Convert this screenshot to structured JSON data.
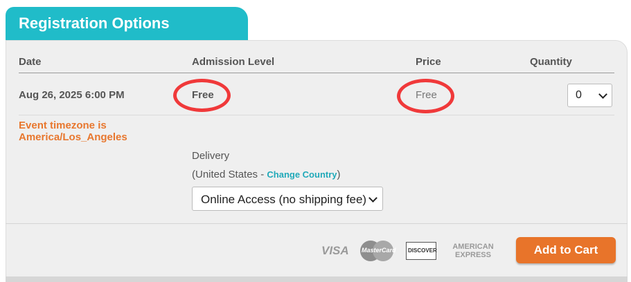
{
  "section": {
    "title": "Registration Options"
  },
  "table": {
    "headers": {
      "date": "Date",
      "admission": "Admission Level",
      "price": "Price",
      "quantity": "Quantity"
    },
    "row": {
      "date": "Aug 26, 2025 6:00 PM",
      "timezone": "Event timezone is America/Los_Angeles",
      "admission": "Free",
      "price": "Free",
      "quantity": "0"
    }
  },
  "delivery": {
    "label": "Delivery",
    "country_prefix": "(United States - ",
    "change_country": "Change Country",
    "country_suffix": ")",
    "shipping_option": "Online Access (no shipping fee)"
  },
  "payment": {
    "visa": "VISA",
    "mastercard": "MasterCard",
    "discover": "DISCOVER",
    "amex_line1": "AMERICAN",
    "amex_line2": "EXPRESS"
  },
  "actions": {
    "add_to_cart": "Add to Cart"
  },
  "colors": {
    "accent": "#20bcc9",
    "orange": "#e8742a",
    "highlight_circle": "#f0393a",
    "panel_bg": "#efefef"
  }
}
